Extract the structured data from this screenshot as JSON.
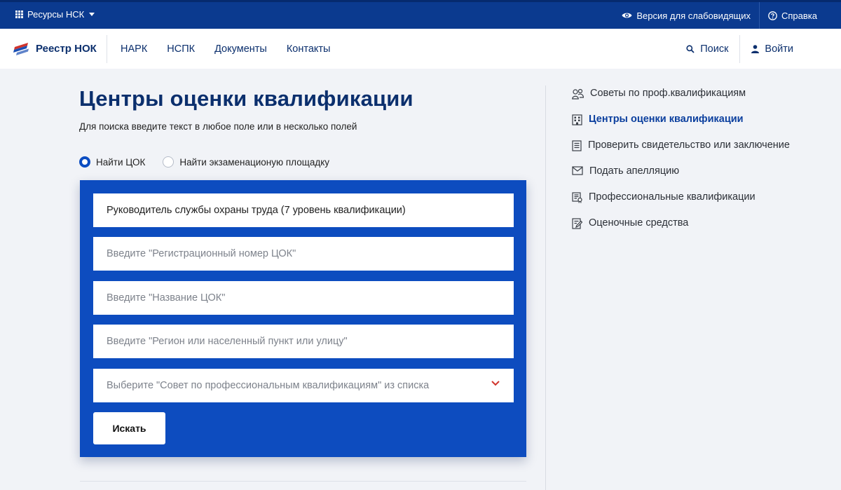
{
  "topbar": {
    "resources_label": "Ресурсы НСК",
    "accessibility_label": "Версия для слабовидящих",
    "help_label": "Справка"
  },
  "header": {
    "logo_text": "Реестр НОК",
    "nav": [
      "НАРК",
      "НСПК",
      "Документы",
      "Контакты"
    ],
    "search_label": "Поиск",
    "login_label": "Войти"
  },
  "main": {
    "title": "Центры оценки квалификации",
    "subtitle": "Для поиска введите текст в любое поле или в несколько полей",
    "radio_options": [
      "Найти ЦОК",
      "Найти экзаменационую площадку"
    ],
    "radio_selected": "Найти ЦОК",
    "fields": {
      "qualification_value": "Руководитель службы охраны труда (7 уровень квалификации)",
      "reg_number_placeholder": "Введите \"Регистрационный номер ЦОК\"",
      "name_placeholder": "Введите \"Название ЦОК\"",
      "region_placeholder": "Введите \"Регион или населенный пункт или улицу\"",
      "council_placeholder": "Выберите \"Совет по профессиональным квалификациям\" из списка"
    },
    "search_button": "Искать"
  },
  "side_menu": {
    "items": [
      {
        "label": "Советы по проф.квалификациям",
        "icon": "people-icon"
      },
      {
        "label": "Центры оценки квалификации",
        "icon": "building-icon",
        "active": true
      },
      {
        "label": "Проверить свидетельство или заключение",
        "icon": "document-icon"
      },
      {
        "label": "Подать апелляцию",
        "icon": "envelope-icon"
      },
      {
        "label": "Профессиональные квалификации",
        "icon": "certificate-icon"
      },
      {
        "label": "Оценочные средства",
        "icon": "edit-document-icon"
      }
    ]
  },
  "colors": {
    "topbar": "#0b3a8f",
    "panel": "#0d4cbf",
    "title": "#0b2f6d",
    "accent_red": "#d0342c"
  }
}
